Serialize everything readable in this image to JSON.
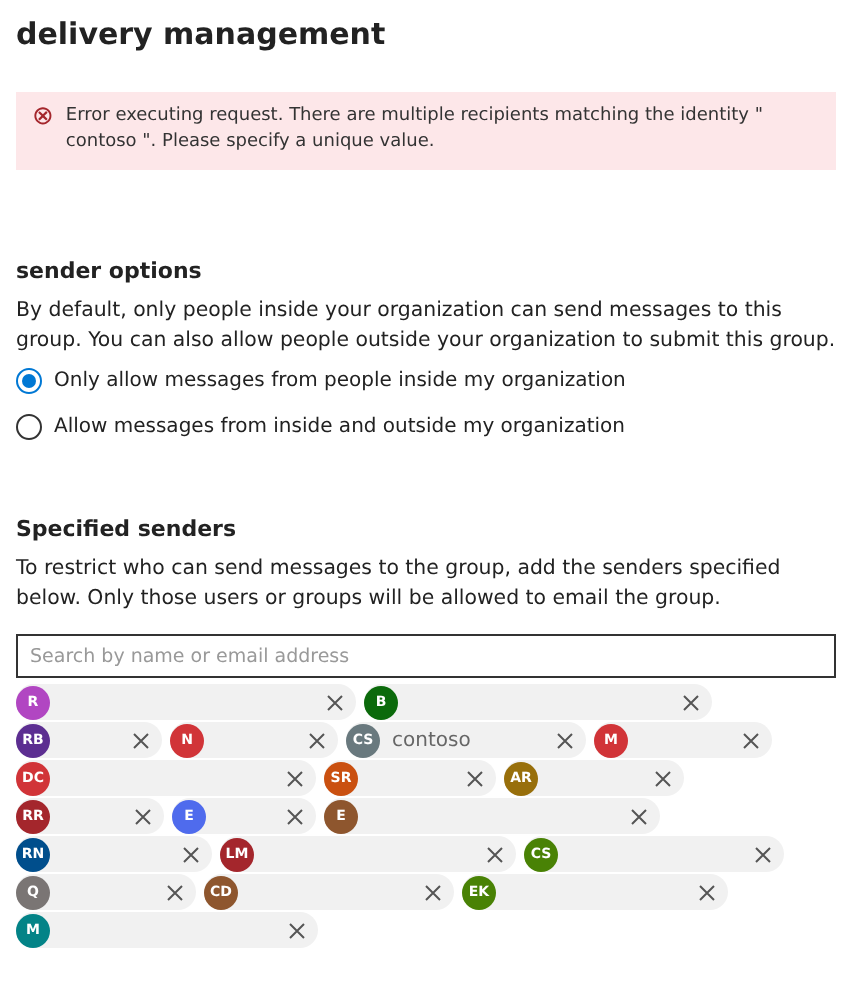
{
  "title": "delivery management",
  "error": {
    "icon": "⊗",
    "text": "Error executing request. There are multiple recipients matching the identity \" contoso \". Please specify a unique value."
  },
  "sender_options": {
    "heading": "sender options",
    "description": "By default, only people inside your organization can send messages to this group. You can also allow people outside your organization to submit this group.",
    "options": [
      {
        "label": "Only allow messages from people inside my organization",
        "selected": true
      },
      {
        "label": "Allow messages from inside and outside my organization",
        "selected": false
      }
    ]
  },
  "specified_senders": {
    "heading": "Specified senders",
    "description": "To restrict who can send messages to the group, add the senders specified below. Only those users or groups will be allowed to email the group.",
    "search": {
      "placeholder": "Search by name or email address"
    },
    "senders": [
      {
        "initials": "R",
        "color": "#b146c2"
      },
      {
        "initials": "B",
        "color": "#0b6a0b"
      },
      {
        "initials": "RB",
        "color": "#5c2e91"
      },
      {
        "initials": "N",
        "color": "#d13438"
      },
      {
        "initials": "CS",
        "color": "#69797e",
        "name": "contoso"
      },
      {
        "initials": "M",
        "color": "#d13438"
      },
      {
        "initials": "DC",
        "color": "#d13438"
      },
      {
        "initials": "SR",
        "color": "#ca5010"
      },
      {
        "initials": "AR",
        "color": "#986f0b"
      },
      {
        "initials": "RR",
        "color": "#a4262c"
      },
      {
        "initials": "E",
        "color": "#4f6bed"
      },
      {
        "initials": "E",
        "color": "#8e562e"
      },
      {
        "initials": "RN",
        "color": "#004e8c"
      },
      {
        "initials": "LM",
        "color": "#a4262c"
      },
      {
        "initials": "CS",
        "color": "#498205"
      },
      {
        "initials": "Q",
        "color": "#7a7574"
      },
      {
        "initials": "CD",
        "color": "#8e562e"
      },
      {
        "initials": "EK",
        "color": "#498205"
      },
      {
        "initials": "M",
        "color": "#038387"
      }
    ]
  }
}
